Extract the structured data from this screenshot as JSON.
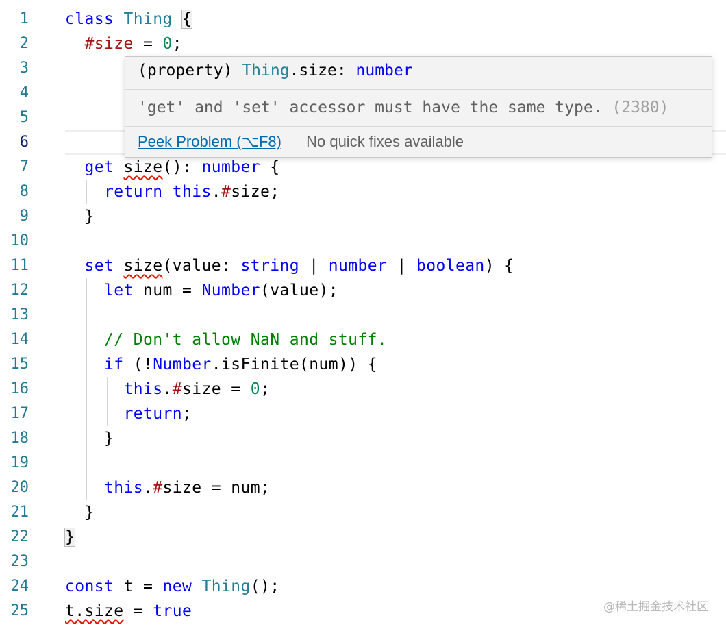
{
  "editor": {
    "line_numbers": [
      "1",
      "2",
      "3",
      "4",
      "5",
      "6",
      "7",
      "8",
      "9",
      "10",
      "11",
      "12",
      "13",
      "14",
      "15",
      "16",
      "17",
      "18",
      "19",
      "20",
      "21",
      "22",
      "23",
      "24",
      "25"
    ],
    "lines": [
      [
        {
          "t": "class ",
          "c": "kw"
        },
        {
          "t": "Thing",
          "c": "ty"
        },
        {
          "t": " "
        },
        {
          "t": "{",
          "c": "plain",
          "bm": true
        }
      ],
      [
        {
          "t": "  "
        },
        {
          "t": "#size",
          "c": "priv"
        },
        {
          "t": " = "
        },
        {
          "t": "0",
          "c": "num"
        },
        {
          "t": ";"
        }
      ],
      [],
      [],
      [],
      [],
      [
        {
          "t": "  "
        },
        {
          "t": "get",
          "c": "kw"
        },
        {
          "t": " "
        },
        {
          "t": "size",
          "sq": true
        },
        {
          "t": "(): "
        },
        {
          "t": "number",
          "c": "kw"
        },
        {
          "t": " {"
        }
      ],
      [
        {
          "t": "    "
        },
        {
          "t": "return",
          "c": "kw"
        },
        {
          "t": " "
        },
        {
          "t": "this",
          "c": "kw"
        },
        {
          "t": "."
        },
        {
          "t": "#",
          "c": "priv"
        },
        {
          "t": "size;"
        }
      ],
      [
        {
          "t": "  }"
        }
      ],
      [],
      [
        {
          "t": "  "
        },
        {
          "t": "set",
          "c": "kw"
        },
        {
          "t": " "
        },
        {
          "t": "size",
          "sq": true
        },
        {
          "t": "(value: "
        },
        {
          "t": "string",
          "c": "kw"
        },
        {
          "t": " | "
        },
        {
          "t": "number",
          "c": "kw"
        },
        {
          "t": " | "
        },
        {
          "t": "boolean",
          "c": "kw"
        },
        {
          "t": ") {"
        }
      ],
      [
        {
          "t": "    "
        },
        {
          "t": "let",
          "c": "kw"
        },
        {
          "t": " num = "
        },
        {
          "t": "Number",
          "c": "kw"
        },
        {
          "t": "(value);"
        }
      ],
      [],
      [
        {
          "t": "    "
        },
        {
          "t": "// Don't allow NaN and stuff.",
          "c": "cmt"
        }
      ],
      [
        {
          "t": "    "
        },
        {
          "t": "if",
          "c": "kw"
        },
        {
          "t": " (!"
        },
        {
          "t": "Number",
          "c": "kw"
        },
        {
          "t": ".isFinite(num)) {"
        }
      ],
      [
        {
          "t": "      "
        },
        {
          "t": "this",
          "c": "kw"
        },
        {
          "t": "."
        },
        {
          "t": "#",
          "c": "priv"
        },
        {
          "t": "size = "
        },
        {
          "t": "0",
          "c": "num"
        },
        {
          "t": ";"
        }
      ],
      [
        {
          "t": "      "
        },
        {
          "t": "return",
          "c": "kw"
        },
        {
          "t": ";"
        }
      ],
      [
        {
          "t": "    }"
        }
      ],
      [],
      [
        {
          "t": "    "
        },
        {
          "t": "this",
          "c": "kw"
        },
        {
          "t": "."
        },
        {
          "t": "#",
          "c": "priv"
        },
        {
          "t": "size = num;"
        }
      ],
      [
        {
          "t": "  }"
        }
      ],
      [
        {
          "t": "}",
          "c": "plain",
          "bm": true
        }
      ],
      [],
      [
        {
          "t": "const",
          "c": "kw"
        },
        {
          "t": " t = "
        },
        {
          "t": "new",
          "c": "kw"
        },
        {
          "t": " "
        },
        {
          "t": "Thing",
          "c": "ty"
        },
        {
          "t": "();"
        }
      ],
      [
        {
          "t": "t.size",
          "sq": true
        },
        {
          "t": " = "
        },
        {
          "t": "true",
          "c": "kw"
        }
      ]
    ],
    "current_line": "6"
  },
  "hover": {
    "sig_open": "(property) ",
    "sig_class": "Thing",
    "sig_prop": ".size: ",
    "sig_type": "number",
    "message": "'get' and 'set' accessor must have the same type.",
    "error_code": "(2380)",
    "peek_label": "Peek Problem (⌥F8)",
    "no_fix_label": "No quick fixes available"
  },
  "watermark": "@稀土掘金技术社区",
  "colors": {
    "keyword": "#0000ff",
    "type": "#267f99",
    "number": "#098658",
    "private": "#a31515",
    "comment": "#008000",
    "squiggle": "#e51400",
    "line_number": "#237893",
    "link": "#006ab1"
  }
}
